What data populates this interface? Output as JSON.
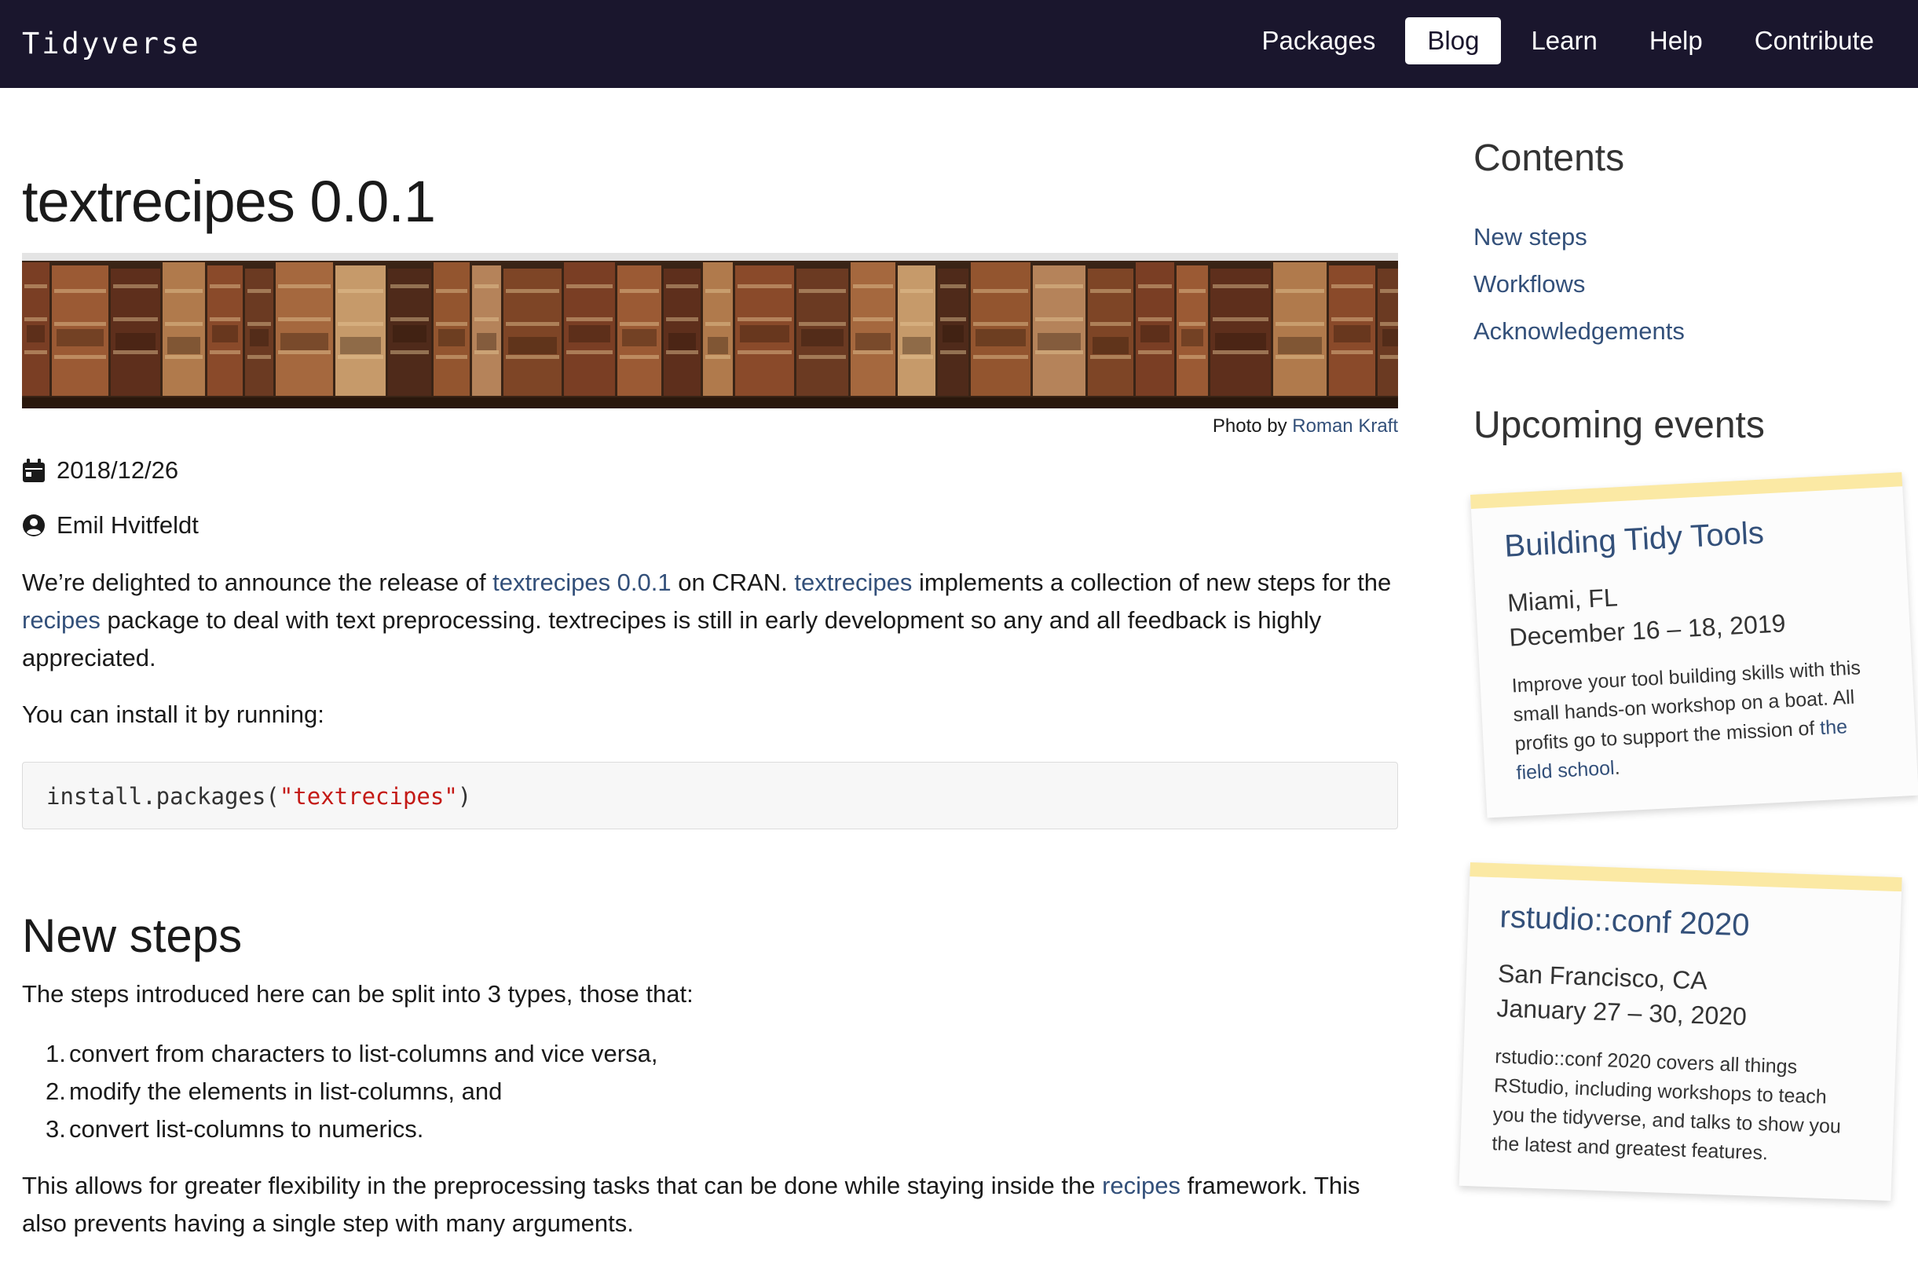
{
  "nav": {
    "brand": "Tidyverse",
    "links": [
      {
        "label": "Packages",
        "active": false
      },
      {
        "label": "Blog",
        "active": true
      },
      {
        "label": "Learn",
        "active": false
      },
      {
        "label": "Help",
        "active": false
      },
      {
        "label": "Contribute",
        "active": false
      }
    ]
  },
  "post": {
    "title": "textrecipes 0.0.1",
    "banner_icon": "bookshelf-photo",
    "credit": {
      "prefix": "Photo by ",
      "author": "Roman Kraft"
    },
    "date": "2018/12/26",
    "date_icon": "calendar-icon",
    "author": "Emil Hvitfeldt",
    "author_icon": "user-circle-icon",
    "intro": {
      "p1_t1": "We’re delighted to announce the release of ",
      "p1_link1": "textrecipes 0.0.1",
      "p1_t2": " on CRAN. ",
      "p1_link2": "textrecipes",
      "p1_t3": " implements a collection of new steps for the ",
      "p1_link3": "recipes",
      "p1_t4": " package to deal with text preprocessing. textrecipes is still in early development so any and all feedback is highly appreciated.",
      "p2": "You can install it by running:"
    },
    "code": {
      "fn": "install.packages(",
      "str": "\"textrecipes\"",
      "close": ")"
    },
    "section": {
      "heading": "New steps",
      "lead": "The steps introduced here can be split into 3 types, those that:",
      "items": [
        {
          "num": "1.",
          "text": "convert from characters to list-columns and vice versa,"
        },
        {
          "num": "2.",
          "text": "modify the elements in list-columns, and"
        },
        {
          "num": "3.",
          "text": "convert list-columns to numerics."
        }
      ],
      "after_t1": "This allows for greater flexibility in the preprocessing tasks that can be done while staying inside the ",
      "after_link": "recipes",
      "after_t2": " framework. This also prevents having a single step with many arguments."
    }
  },
  "sidebar": {
    "contents_title": "Contents",
    "toc": [
      "New steps",
      "Workflows",
      "Acknowledgements"
    ],
    "events_title": "Upcoming events",
    "events": [
      {
        "name": "Building Tidy Tools",
        "place": "Miami, FL",
        "date": "December 16 – 18, 2019",
        "desc_t1": "Improve your tool building skills with this small hands-on workshop on a boat. All profits go to support the mission of ",
        "desc_link": "the field school",
        "desc_t2": "."
      },
      {
        "name": "rstudio::conf 2020",
        "place": "San Francisco, CA",
        "date": "January 27 – 30, 2020",
        "desc_t1": "rstudio::conf 2020 covers all things RStudio, including workshops to teach you the tidyverse, and talks to show you the latest and greatest features.",
        "desc_link": "",
        "desc_t2": ""
      }
    ]
  },
  "colors": {
    "navbar": "#1a162d",
    "link": "#33507a",
    "tape": "#fbe9a4",
    "code_string": "#c41a16"
  }
}
